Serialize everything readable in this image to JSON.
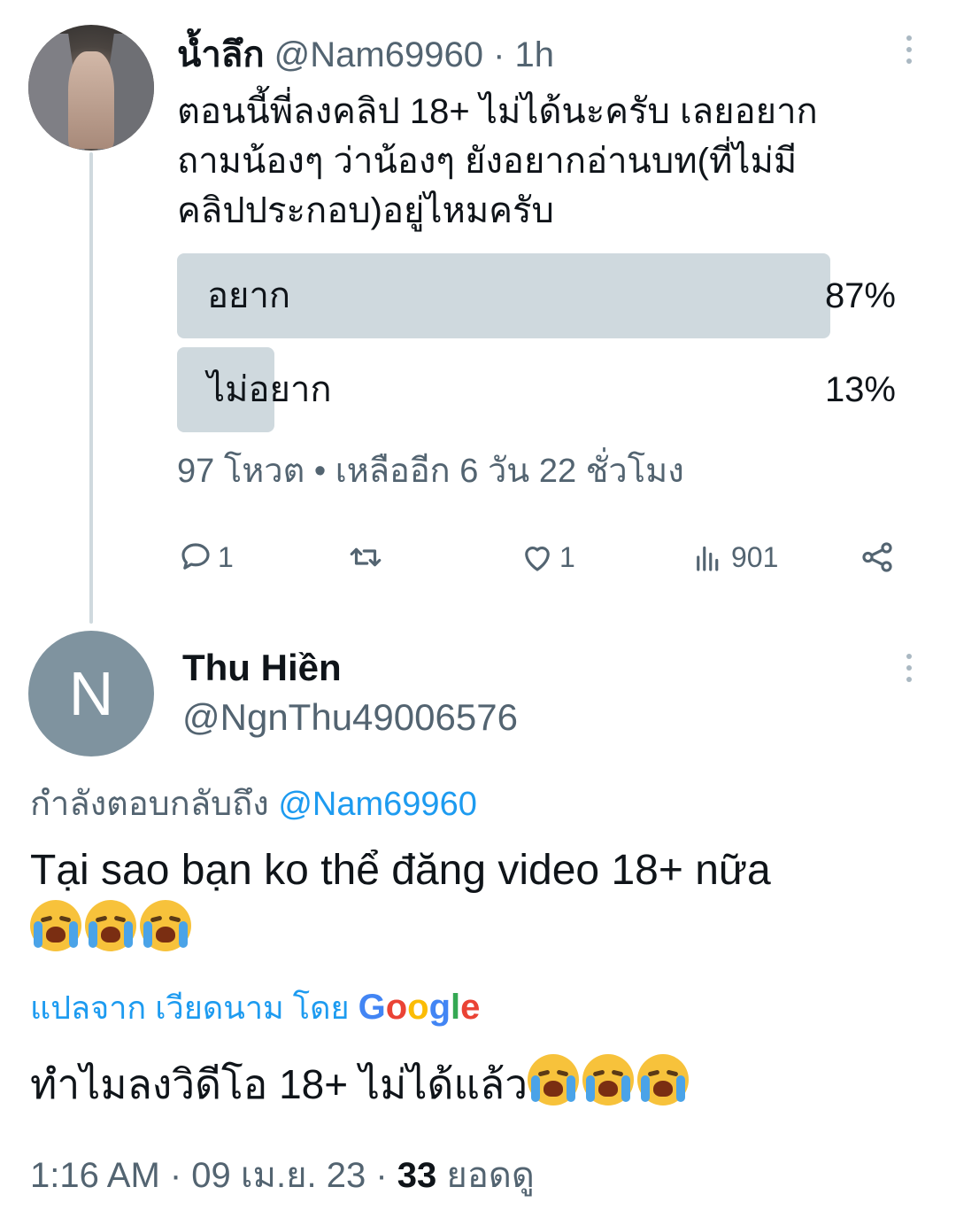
{
  "parent_tweet": {
    "display_name": "น้ำลึก",
    "handle": "@Nam69960",
    "time_ago": "1h",
    "text": "ตอนนี้พี่ลงคลิป 18+ ไม่ได้นะครับ เลยอยาก\nถามน้องๆ ว่าน้องๆ ยังอยากอ่านบท(ที่ไม่มี\nคลิปประกอบ)อยู่ไหมครับ",
    "poll": {
      "options": [
        {
          "label": "อยาก",
          "percent_text": "87%",
          "percent": 87
        },
        {
          "label": "ไม่อยาก",
          "percent_text": "13%",
          "percent": 13
        }
      ],
      "meta": "97 โหวต • เหลืออีก 6 วัน 22 ชั่วโมง"
    },
    "actions": {
      "reply_count": "1",
      "retweet_count": "",
      "like_count": "1",
      "view_count": "901"
    }
  },
  "reply": {
    "avatar_letter": "N",
    "display_name": "Thu Hiền",
    "handle": "@NgnThu49006576",
    "replying_label": "กำลังตอบกลับถึง",
    "replying_to": "@Nam69960",
    "text": "Tại sao bạn ko thể đăng video 18+ nữa",
    "translate_label": "แปลจาก เวียดนาม โดย",
    "translate_brand": [
      "G",
      "o",
      "o",
      "g",
      "l",
      "e"
    ],
    "translated_text": "ทำไมลงวิดีโอ 18+ ไม่ได้แล้ว",
    "timestamp": "1:16 AM · 09 เม.ย. 23 · ",
    "views_count": "33",
    "views_label": " ยอดดู"
  },
  "colors": {
    "accent": "#1d9bf0",
    "secondary_text": "#536471",
    "poll_bar": "#cfd9de",
    "avatar_bg": "#7f939f"
  }
}
